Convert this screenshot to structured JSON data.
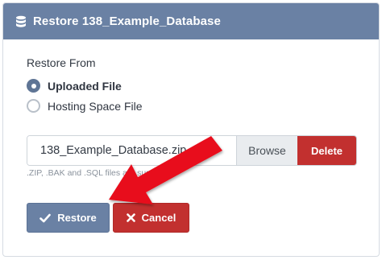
{
  "dialog": {
    "title": "Restore 138_Example_Database",
    "title_icon": "database-icon"
  },
  "restore_from": {
    "label": "Restore From",
    "options": [
      {
        "label": "Uploaded File",
        "selected": true
      },
      {
        "label": "Hosting Space File",
        "selected": false
      }
    ]
  },
  "file_input": {
    "value": "138_Example_Database.zip",
    "browse_label": "Browse",
    "delete_label": "Delete",
    "hint": ".ZIP, .BAK and .SQL files are supported"
  },
  "actions": {
    "restore_label": "Restore",
    "restore_icon": "check-icon",
    "cancel_label": "Cancel",
    "cancel_icon": "close-icon"
  },
  "colors": {
    "header": "#6a81a4",
    "primary": "#6a81a4",
    "danger": "#c2302f",
    "annotation_arrow": "#e8111b"
  }
}
